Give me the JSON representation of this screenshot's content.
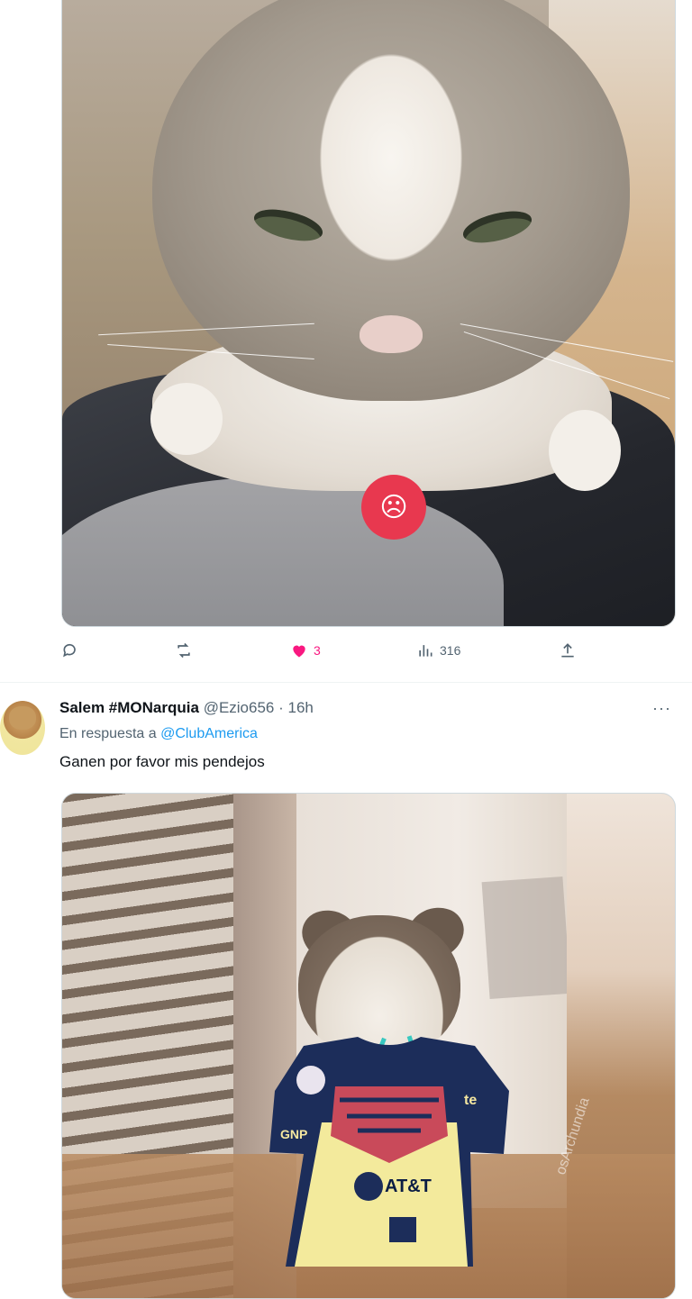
{
  "tweet1": {
    "media": {
      "alt": "",
      "overlay_emoji_icon": "angry-face-icon"
    },
    "actions": {
      "reply_icon": "reply-icon",
      "retweet_icon": "retweet-icon",
      "like_icon": "heart-filled-icon",
      "like_count": "3",
      "views_icon": "views-chart-icon",
      "views_count": "316",
      "share_icon": "share-icon"
    },
    "colors": {
      "like": "#f91880",
      "muted": "#536471"
    }
  },
  "tweet2": {
    "display_name": "Salem #MONarquia",
    "handle": "@Ezio656",
    "separator": " · ",
    "time": "16h",
    "more": "···",
    "reply_prefix": "En respuesta a ",
    "reply_to": "@ClubAmerica",
    "text": "Ganen por favor mis pendejos",
    "media": {
      "jersey_sponsor_1": "AT&T",
      "jersey_sponsor_2": "GNP",
      "jersey_sponsor_3": "te",
      "watermark": "osArchundia"
    },
    "colors": {
      "link": "#1d9bf0"
    }
  }
}
